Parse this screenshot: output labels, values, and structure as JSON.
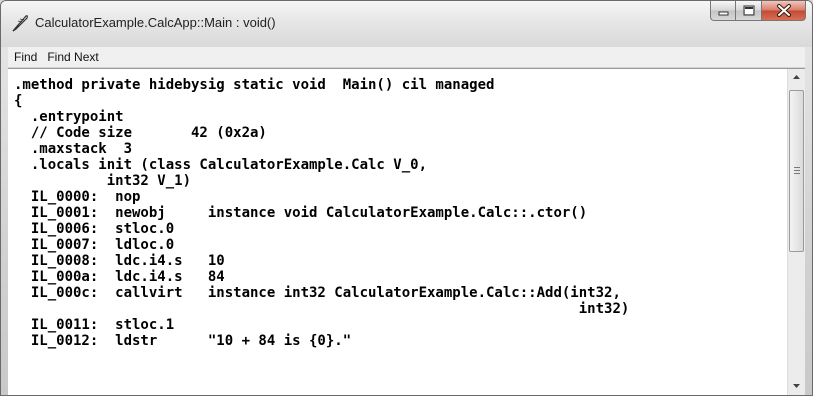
{
  "window": {
    "title": "CalculatorExample.CalcApp::Main : void()"
  },
  "menu": {
    "items": [
      "Find",
      "Find Next"
    ]
  },
  "code": {
    "lines": [
      ".method private hidebysig static void  Main() cil managed",
      "{",
      "  .entrypoint",
      "  // Code size       42 (0x2a)",
      "  .maxstack  3",
      "  .locals init (class CalculatorExample.Calc V_0,",
      "           int32 V_1)",
      "  IL_0000:  nop",
      "  IL_0001:  newobj     instance void CalculatorExample.Calc::.ctor()",
      "  IL_0006:  stloc.0",
      "  IL_0007:  ldloc.0",
      "  IL_0008:  ldc.i4.s   10",
      "  IL_000a:  ldc.i4.s   84",
      "  IL_000c:  callvirt   instance int32 CalculatorExample.Calc::Add(int32,",
      "                                                                   int32)",
      "  IL_0011:  stloc.1",
      "  IL_0012:  ldstr      \"10 + 84 is {0}.\""
    ]
  },
  "icons": {
    "app": "quill-pen-icon",
    "minimize": "minimize-icon",
    "maximize": "maximize-icon",
    "close": "close-icon",
    "scroll_up": "scroll-up-arrow-icon",
    "scroll_down": "scroll-down-arrow-icon"
  },
  "colors": {
    "close_button": "#c9503a",
    "editor_background": "#ffffff"
  }
}
